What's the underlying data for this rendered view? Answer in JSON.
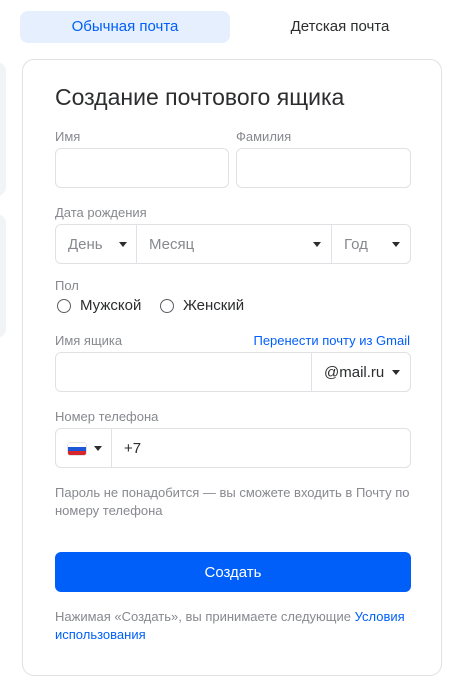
{
  "tabs": {
    "regular": "Обычная почта",
    "kids": "Детская почта"
  },
  "form": {
    "title": "Создание почтового ящика",
    "first_name_label": "Имя",
    "last_name_label": "Фамилия",
    "first_name_value": "",
    "last_name_value": "",
    "birthdate_label": "Дата рождения",
    "day_placeholder": "День",
    "month_placeholder": "Месяц",
    "year_placeholder": "Год",
    "gender_label": "Пол",
    "gender_male": "Мужской",
    "gender_female": "Женский",
    "mailbox_label": "Имя ящика",
    "transfer_link": "Перенести почту из Gmail",
    "mailbox_value": "",
    "domain_value": "@mail.ru",
    "phone_label": "Номер телефона",
    "country_flag": "russia-flag",
    "phone_value": "+7",
    "phone_hint": "Пароль не понадобится — вы сможете входить в Почту по номеру телефона",
    "submit_label": "Создать",
    "terms_text": "Нажимая «Создать», вы принимаете следующие ",
    "terms_link": "Условия использования"
  },
  "colors": {
    "accent": "#005ff9",
    "active_tab_bg": "#e5effd",
    "muted_text": "#87898f",
    "border": "#dfe1e5"
  }
}
